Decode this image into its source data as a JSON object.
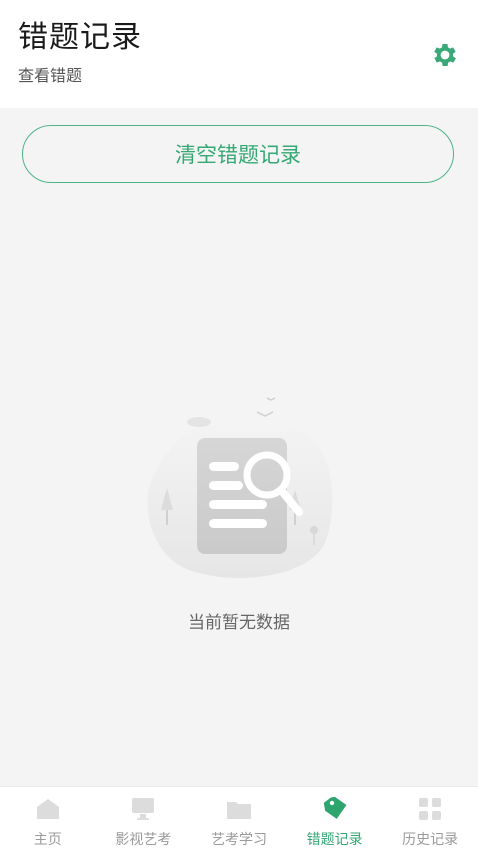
{
  "header": {
    "title": "错题记录",
    "subtitle": "查看错题",
    "settings_icon": "gear-icon"
  },
  "actions": {
    "clear_label": "清空错题记录"
  },
  "empty_state": {
    "icon": "empty-document-search-icon",
    "text": "当前暂无数据"
  },
  "tabbar": {
    "items": [
      {
        "label": "主页",
        "icon": "home-icon",
        "active": false
      },
      {
        "label": "影视艺考",
        "icon": "monitor-icon",
        "active": false
      },
      {
        "label": "艺考学习",
        "icon": "folder-icon",
        "active": false
      },
      {
        "label": "错题记录",
        "icon": "tag-icon",
        "active": true
      },
      {
        "label": "历史记录",
        "icon": "grid-icon",
        "active": false
      }
    ]
  },
  "colors": {
    "accent": "#35a874",
    "inactive": "#9a9a9a",
    "background": "#f4f4f4"
  }
}
